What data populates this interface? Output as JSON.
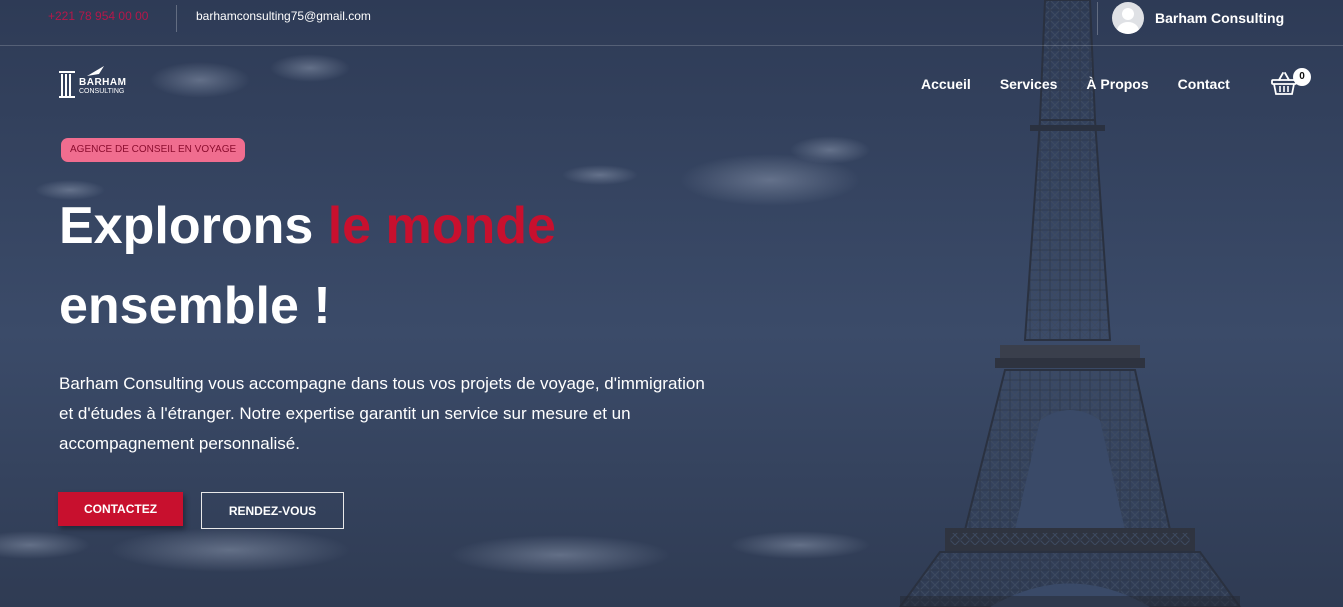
{
  "topbar": {
    "phone": "+221 78 954 00 00",
    "email": "barhamconsulting75@gmail.com",
    "user_name": "Barham Consulting"
  },
  "header": {
    "logo": {
      "line1": "BARHAM",
      "line2": "CONSULTING"
    },
    "nav": [
      {
        "label": "Accueil"
      },
      {
        "label": "Services"
      },
      {
        "label": "À Propos"
      },
      {
        "label": "Contact"
      }
    ],
    "cart_count": "0"
  },
  "hero": {
    "tag": "AGENCE DE CONSEIL EN VOYAGE",
    "headline_part1": "Explorons ",
    "headline_accent": "le monde",
    "headline_part2": "ensemble !",
    "description": "Barham Consulting vous accompagne dans tous vos projets de voyage, d'immigration et d'études à l'étranger. Notre expertise garantit un service sur mesure et un accompagnement personnalisé.",
    "primary_button": "CONTACTEZ",
    "secondary_button": "RENDEZ-VOUS"
  },
  "colors": {
    "accent": "#c8102e",
    "tag_background": "#f06d8f",
    "phone_text": "#b5174a",
    "overlay": "#334260"
  },
  "icons": {
    "avatar": "user-avatar-icon",
    "cart": "shopping-basket-icon",
    "background": "eiffel-tower-image"
  }
}
